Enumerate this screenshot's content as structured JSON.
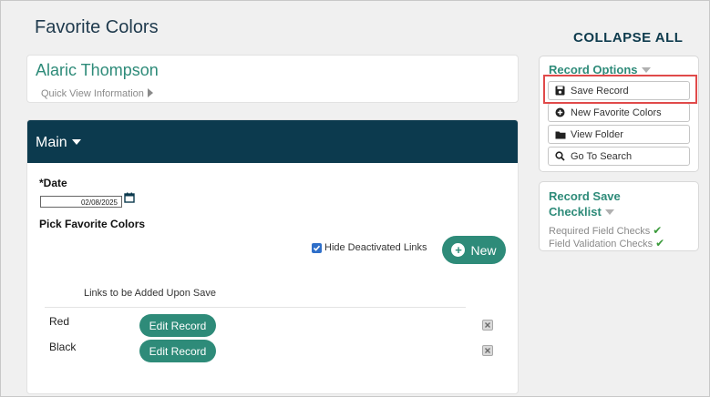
{
  "page": {
    "title": "Favorite Colors",
    "collapse_all": "COLLAPSE ALL"
  },
  "person": {
    "name": "Alaric Thompson",
    "quick_view": "Quick View Information"
  },
  "main": {
    "header": "Main",
    "date_label": "*Date",
    "date_value": "02/08/2025",
    "pick_label": "Pick Favorite Colors",
    "hide_deactivated_label": "Hide Deactivated Links",
    "hide_deactivated_checked": true,
    "new_button": "New",
    "links_label": "Links to be Added Upon Save",
    "rows": [
      {
        "name": "Red",
        "action": "Edit Record"
      },
      {
        "name": "Black",
        "action": "Edit Record"
      }
    ]
  },
  "record_options": {
    "title": "Record Options",
    "items": [
      {
        "label": "Save Record",
        "icon": "save-icon"
      },
      {
        "label": "New Favorite Colors",
        "icon": "plus-circle-icon"
      },
      {
        "label": "View Folder",
        "icon": "folder-icon"
      },
      {
        "label": "Go To Search",
        "icon": "search-icon"
      }
    ]
  },
  "checklist": {
    "title_line1": "Record Save",
    "title_line2": "Checklist",
    "items": [
      {
        "label": "Required Field Checks",
        "status": "passed"
      },
      {
        "label": "Field Validation Checks",
        "status": "passed"
      }
    ]
  },
  "colors": {
    "primary_teal": "#2e8b79",
    "header_navy": "#0c3a4e",
    "highlight_red": "#e04a4a",
    "check_green": "#3a9a3a"
  }
}
